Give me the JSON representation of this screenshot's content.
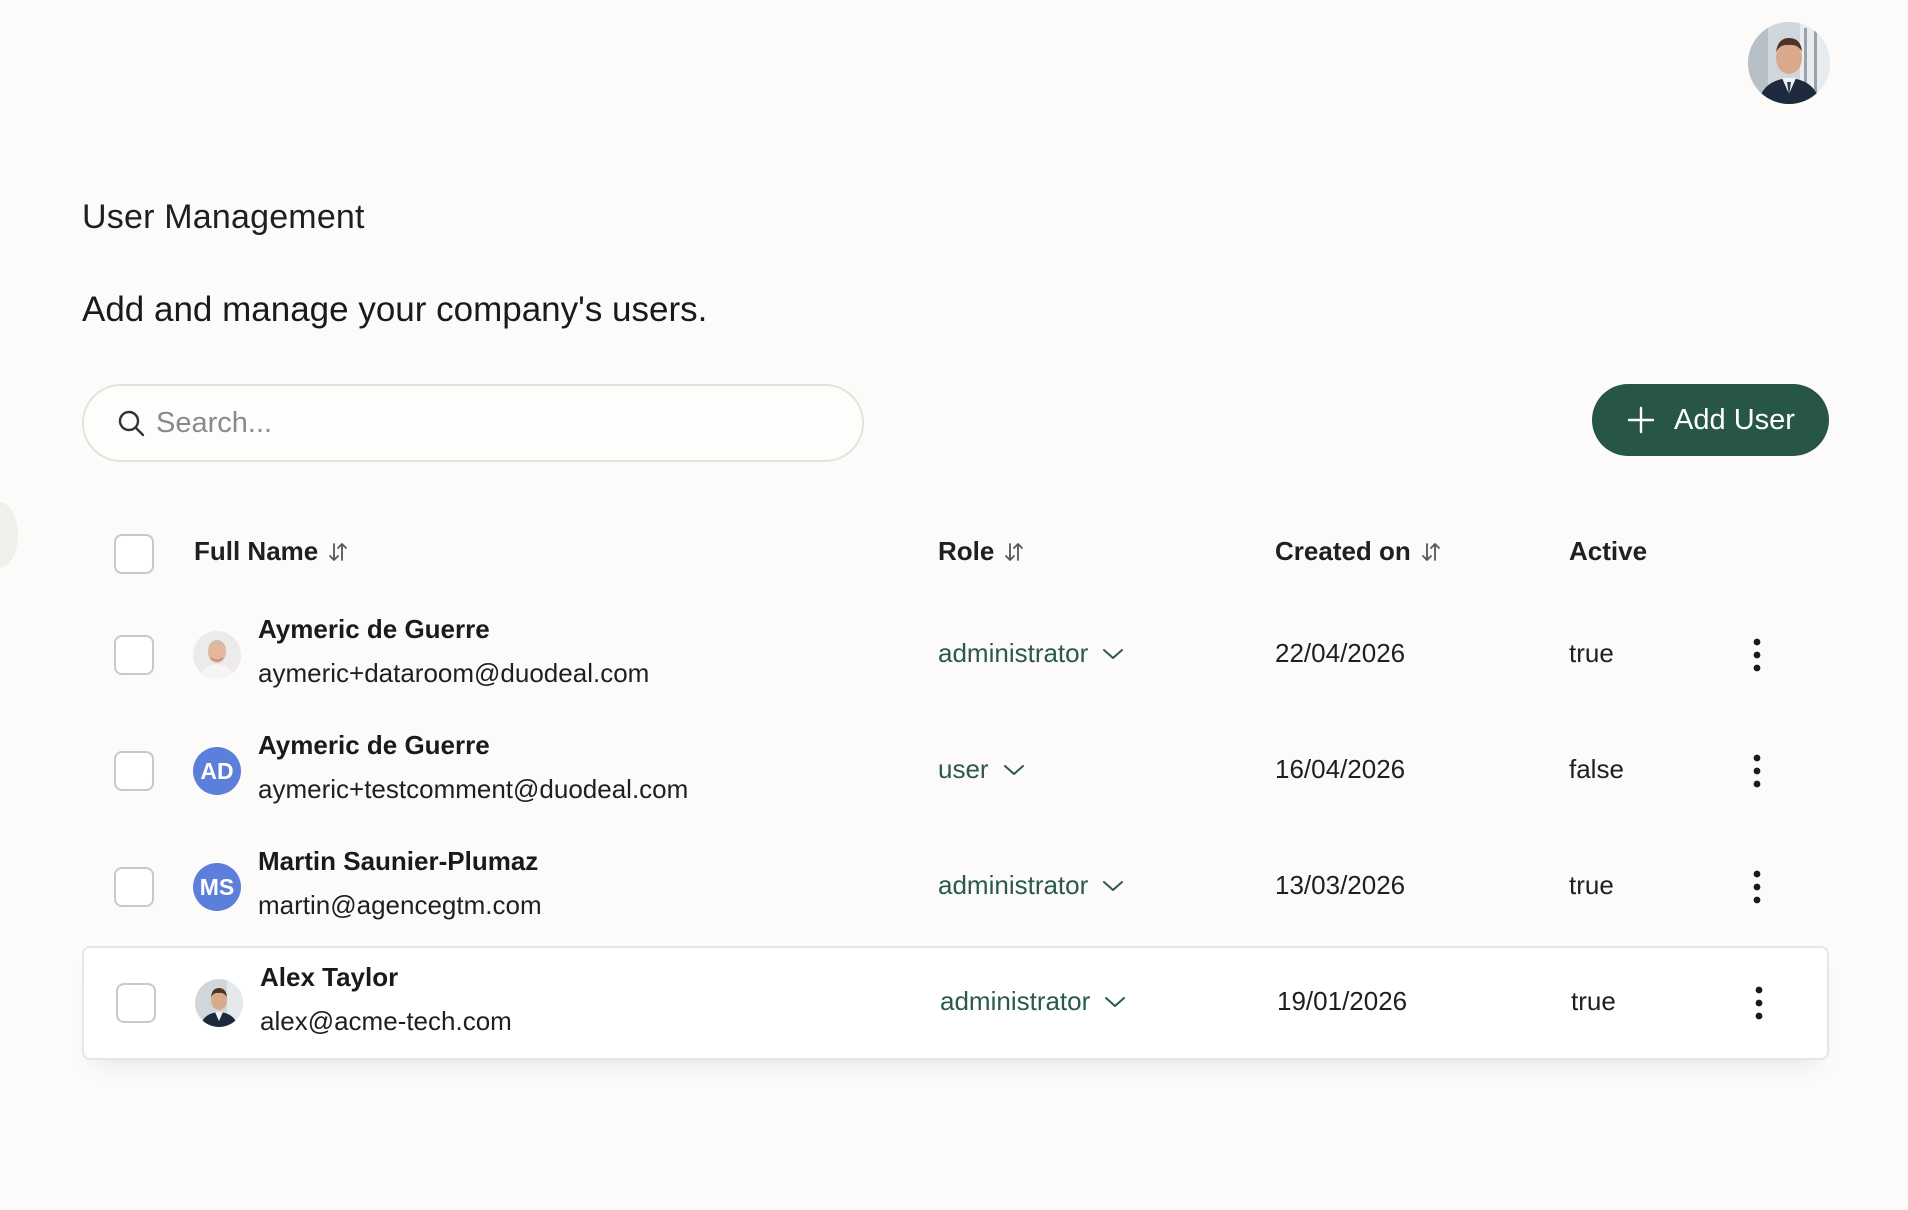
{
  "header": {
    "profile_avatar": "profile-photo"
  },
  "page": {
    "title": "User Management",
    "subtitle": "Add and manage your company's users."
  },
  "search": {
    "placeholder": "Search...",
    "value": "",
    "icon": "search-icon"
  },
  "add_button": {
    "label": "Add User",
    "icon": "plus-icon"
  },
  "table": {
    "columns": {
      "full_name": "Full Name",
      "role": "Role",
      "created_on": "Created on",
      "active": "Active"
    },
    "rows": [
      {
        "avatar_type": "photo",
        "initials": "",
        "name": "Aymeric de Guerre",
        "email": "aymeric+dataroom@duodeal.com",
        "role": "administrator",
        "created_on": "22/04/2026",
        "active": "true"
      },
      {
        "avatar_type": "initials",
        "initials": "AD",
        "name": "Aymeric de Guerre",
        "email": "aymeric+testcomment@duodeal.com",
        "role": "user",
        "created_on": "16/04/2026",
        "active": "false"
      },
      {
        "avatar_type": "initials",
        "initials": "MS",
        "name": "Martin Saunier-Plumaz",
        "email": "martin@agencegtm.com",
        "role": "administrator",
        "created_on": "13/03/2026",
        "active": "true"
      },
      {
        "avatar_type": "photo",
        "initials": "",
        "name": "Alex Taylor",
        "email": "alex@acme-tech.com",
        "role": "administrator",
        "created_on": "19/01/2026",
        "active": "true"
      }
    ]
  },
  "colors": {
    "primary": "#275646",
    "role_text": "#2a5a48",
    "initials_avatar": "#5b7fda",
    "background": "#fcfbfa"
  }
}
